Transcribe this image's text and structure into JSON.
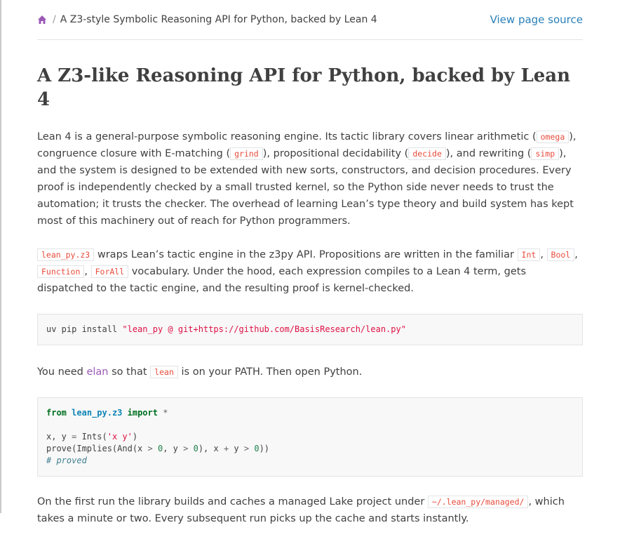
{
  "breadcrumbs": {
    "current": "A Z3-style Symbolic Reasoning API for Python, backed by Lean 4",
    "view_source": "View page source"
  },
  "title": "A Z3-like Reasoning API for Python, backed by Lean 4",
  "para1": {
    "t1": "Lean 4 is a general-purpose symbolic reasoning engine. Its tactic library covers linear arithmetic (",
    "c1": "omega",
    "t2": "), congruence closure with E-matching (",
    "c2": "grind",
    "t3": "), propositional decidability (",
    "c3": "decide",
    "t4": "), and rewriting (",
    "c4": "simp",
    "t5": "), and the system is designed to be extended with new sorts, constructors, and decision procedures. Every proof is independently checked by a small trusted kernel, so the Python side never needs to trust the automation; it trusts the checker. The overhead of learning Lean’s type theory and build system has kept most of this machinery out of reach for Python programmers."
  },
  "para2": {
    "c1": "lean_py.z3",
    "t1": " wraps Lean’s tactic engine in the z3py API. Propositions are written in the familiar ",
    "c2": "Int",
    "t2": ", ",
    "c3": "Bool",
    "t3": ", ",
    "c4": "Function",
    "t4": ", ",
    "c5": "ForAll",
    "t5": " vocabulary. Under the hood, each expression compiles to a Lean 4 term, gets dispatched to the tactic engine, and the resulting proof is kernel-checked."
  },
  "install": {
    "cmd": "uv pip install ",
    "arg": "\"lean_py @ git+https://github.com/BasisResearch/lean.py\""
  },
  "para3": {
    "t1": "You need ",
    "link": "elan",
    "t2": " so that ",
    "c1": "lean",
    "t3": " is on your PATH. Then open Python."
  },
  "example": {
    "kw_from": "from",
    "module": "lean_py.z3",
    "kw_import": "import",
    "star": "*",
    "line2_a": "x, y ",
    "line2_eq": "=",
    "line2_b": " Ints(",
    "line2_str": "'x y'",
    "line2_c": ")",
    "line3_a": "prove(Implies(And(x ",
    "line3_gt1": ">",
    "line3_sp1": " ",
    "line3_n1": "0",
    "line3_b": ", y ",
    "line3_gt2": ">",
    "line3_sp2": " ",
    "line3_n2": "0",
    "line3_c": "), x ",
    "line3_plus": "+",
    "line3_d": " y ",
    "line3_gt3": ">",
    "line3_sp3": " ",
    "line3_n3": "0",
    "line3_e": "))",
    "comment": "# proved"
  },
  "para4": {
    "t1": "On the first run the library builds and caches a managed Lake project under ",
    "c1": "~/.lean_py/managed/",
    "t2": ", which takes a minute or two. Every subsequent run picks up the cache and starts instantly."
  },
  "colors": {
    "link": "#2980b9",
    "visited_link": "#9b59b6",
    "literal": "#e74c3c",
    "home_icon": "#9b59b6"
  },
  "icons": {
    "home": "home-icon"
  }
}
